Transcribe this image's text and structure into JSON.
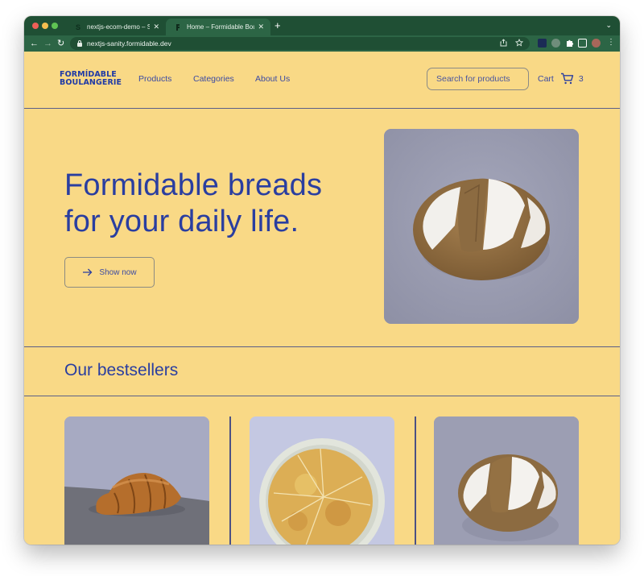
{
  "browser": {
    "tabs": [
      {
        "title": "nextjs-ecom-demo – Sanity",
        "favicon": "sanity-s-icon",
        "active": false
      },
      {
        "title": "Home – Formidable Boulangerie",
        "favicon": "formidable-f-icon",
        "active": true
      }
    ],
    "new_tab_label": "+",
    "close_glyph": "✕",
    "url": "nextjs-sanity.formidable.dev",
    "nav": {
      "back": "←",
      "forward": "→",
      "reload": "↻"
    },
    "omnibox_icons": [
      "share-icon",
      "bookmark-star-icon"
    ],
    "extension_icons": [
      "extension-1-icon",
      "extension-2-icon",
      "puzzle-extensions-icon",
      "sidebar-toggle-icon",
      "profile-avatar"
    ],
    "menu_glyph": "⋮",
    "tab_strip_menu_glyph": "⌄"
  },
  "site": {
    "logo": {
      "line1": "FORMÍDABLE",
      "line2": "BOULANGERIE"
    },
    "nav": [
      {
        "label": "Products"
      },
      {
        "label": "Categories"
      },
      {
        "label": "About Us"
      }
    ],
    "search": {
      "placeholder": "Search for products",
      "value": ""
    },
    "cart": {
      "label": "Cart",
      "count": "3"
    }
  },
  "hero": {
    "title_line1": "Formidable breads",
    "title_line2": "for your daily life.",
    "cta_label": "Show now",
    "cta_icon": "arrow-right-icon",
    "image": "sourdough-loaf"
  },
  "bestsellers": {
    "title": "Our bestsellers",
    "items": [
      {
        "image": "croissant"
      },
      {
        "image": "focaccia-on-plate"
      },
      {
        "image": "sourdough-loaf"
      }
    ]
  },
  "colors": {
    "brand_blue": "#2a3ea0",
    "page_bg": "#f9d986",
    "chrome_green": "#2c6545",
    "divider": "#5b5f88"
  }
}
